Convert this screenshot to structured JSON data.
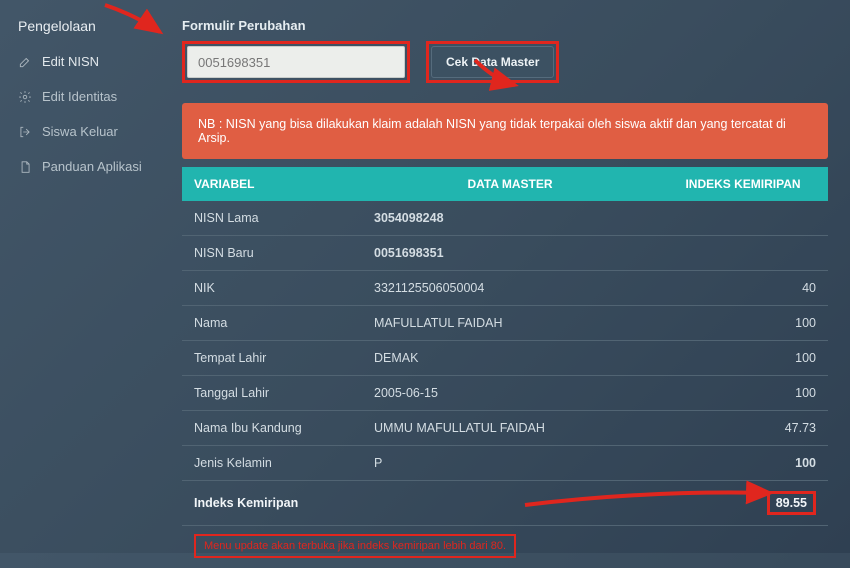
{
  "sidebar": {
    "title": "Pengelolaan",
    "items": [
      {
        "label": "Edit NISN",
        "icon": "edit-icon",
        "active": true
      },
      {
        "label": "Edit Identitas",
        "icon": "gear-icon",
        "active": false
      },
      {
        "label": "Siswa Keluar",
        "icon": "logout-icon",
        "active": false
      },
      {
        "label": "Panduan Aplikasi",
        "icon": "file-icon",
        "active": false
      }
    ]
  },
  "form": {
    "title": "Formulir Perubahan",
    "nisn_value": "0051698351",
    "cek_label": "Cek Data Master"
  },
  "alert_text": "NB : NISN yang bisa dilakukan klaim adalah NISN yang tidak terpakai oleh siswa aktif dan yang tercatat di Arsip.",
  "table": {
    "headers": {
      "var": "VARIABEL",
      "master": "DATA MASTER",
      "score": "INDEKS KEMIRIPAN"
    },
    "rows": [
      {
        "var": "NISN Lama",
        "master": "3054098248",
        "score": "",
        "bold": true
      },
      {
        "var": "NISN Baru",
        "master": "0051698351",
        "score": "",
        "bold": true
      },
      {
        "var": "NIK",
        "master": "3321125506050004",
        "score": "40"
      },
      {
        "var": "Nama",
        "master": "MAFULLATUL FAIDAH",
        "score": "100"
      },
      {
        "var": "Tempat Lahir",
        "master": "DEMAK",
        "score": "100"
      },
      {
        "var": "Tanggal Lahir",
        "master": "2005-06-15",
        "score": "100"
      },
      {
        "var": "Nama Ibu Kandung",
        "master": "UMMU MAFULLATUL FAIDAH",
        "score": "47.73",
        "score_red": true
      },
      {
        "var": "Jenis Kelamin",
        "master": "P",
        "score": "100",
        "score_bold": true
      }
    ],
    "summary": {
      "label": "Indeks Kemiripan",
      "value": "89.55"
    },
    "note": "Menu update akan terbuka jika indeks kemiripan lebih dari 80."
  }
}
